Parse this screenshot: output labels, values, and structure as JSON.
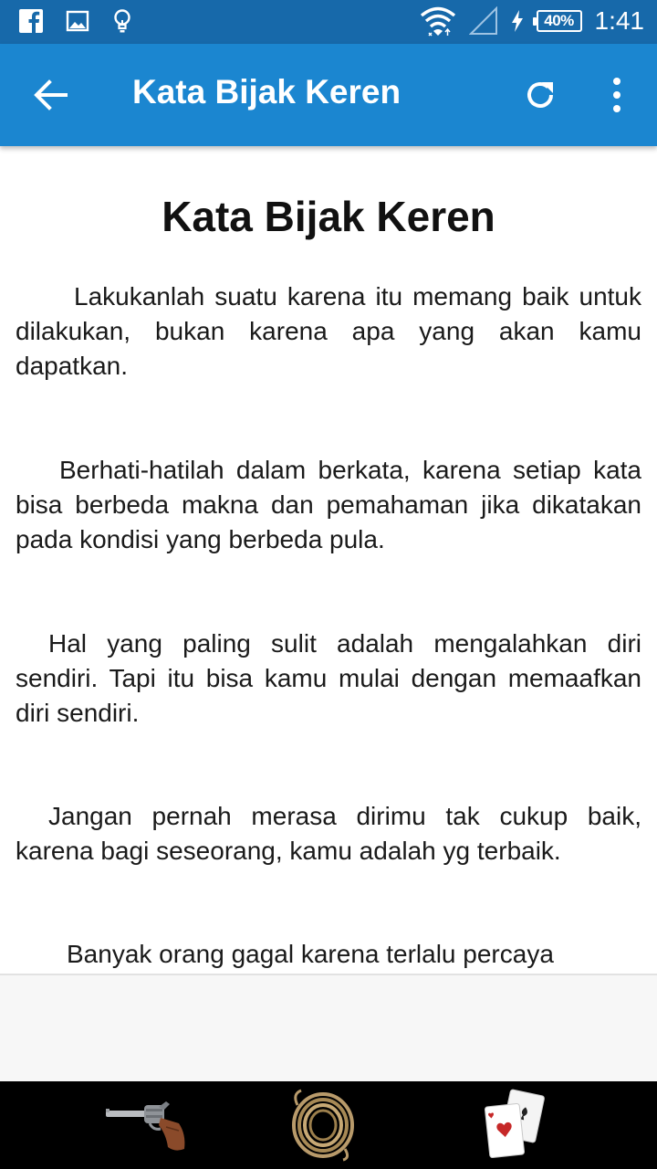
{
  "status_bar": {
    "left_icons": [
      "facebook-icon",
      "image-icon",
      "lightbulb-icon"
    ],
    "right_icons": [
      "wifi-icon",
      "signal-icon",
      "charging-icon"
    ],
    "battery": "40%",
    "time": "1:41"
  },
  "app_bar": {
    "title": "Kata Bijak Keren",
    "icons": [
      "back-arrow-icon",
      "refresh-icon",
      "more-vert-icon"
    ],
    "color": "#1b86d0"
  },
  "article": {
    "title": "Kata Bijak Keren",
    "paragraphs": [
      "Lakukanlah suatu karena itu memang baik untuk dilakukan, bukan karena apa yang akan kamu dapatkan.",
      "Berhati-hatilah dalam berkata, karena setiap kata bisa berbeda makna dan pemahaman jika dikatakan pada kondisi yang berbeda pula.",
      "Hal yang paling sulit adalah mengalahkan diri sendiri. Tapi itu bisa kamu mulai dengan memaafkan diri sendiri.",
      "Jangan pernah merasa dirimu tak cukup baik, karena bagi seseorang, kamu adalah yg terbaik.",
      "Banyak orang gagal karena terlalu percaya"
    ]
  },
  "bottom_bar": {
    "items": [
      "revolver-icon",
      "rope-icon",
      "playing-cards-icon"
    ]
  }
}
